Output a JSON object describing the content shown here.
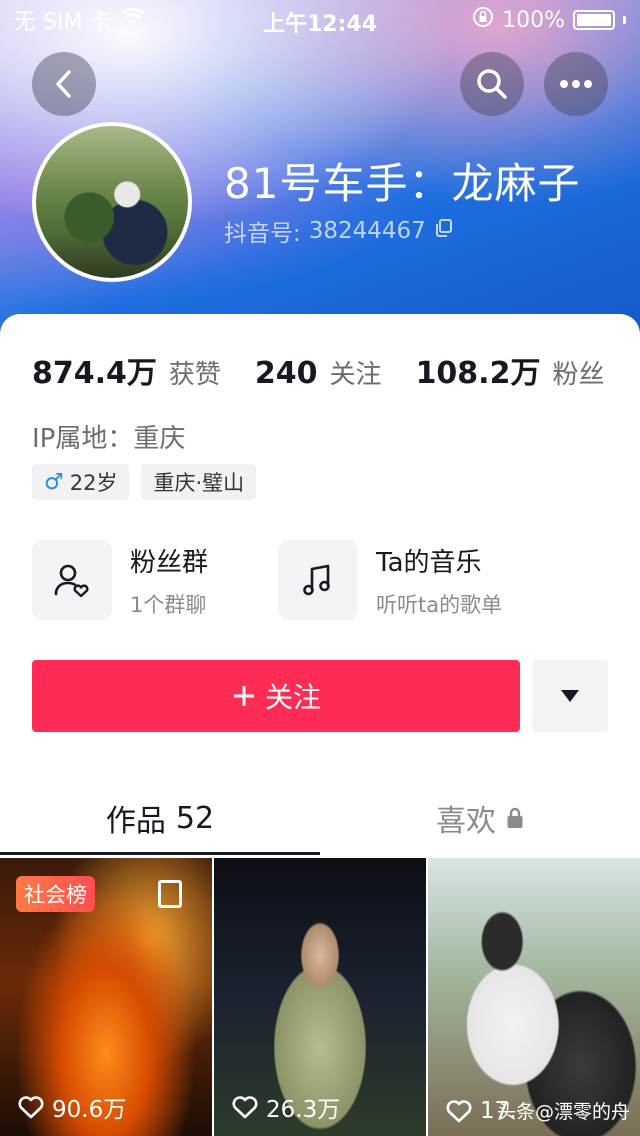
{
  "status_bar": {
    "carrier": "无 SIM 卡",
    "time": "上午12:44",
    "battery": "100%"
  },
  "header": {
    "nickname": "81号车手：龙麻子",
    "douyin_id_label": "抖音号:",
    "douyin_id": "38244467"
  },
  "stats": [
    {
      "num": "874.4万",
      "label": "获赞"
    },
    {
      "num": "240",
      "label": "关注"
    },
    {
      "num": "108.2万",
      "label": "粉丝"
    }
  ],
  "profile": {
    "ip": "IP属地：重庆",
    "tag_age": "22岁",
    "tag_location": "重庆·璧山"
  },
  "features": {
    "fans_title": "粉丝群",
    "fans_sub": "1个群聊",
    "music_title": "Ta的音乐",
    "music_sub": "听听ta的歌单"
  },
  "actions": {
    "follow_label": "关注"
  },
  "tabs": {
    "works_label": "作品",
    "works_count": "52",
    "likes_label": "喜欢"
  },
  "videos": [
    {
      "badge": "社会榜",
      "count": "90.6万"
    },
    {
      "count": "26.3万"
    },
    {
      "count": "17.",
      "watermark": "头条@漂零的舟"
    }
  ]
}
